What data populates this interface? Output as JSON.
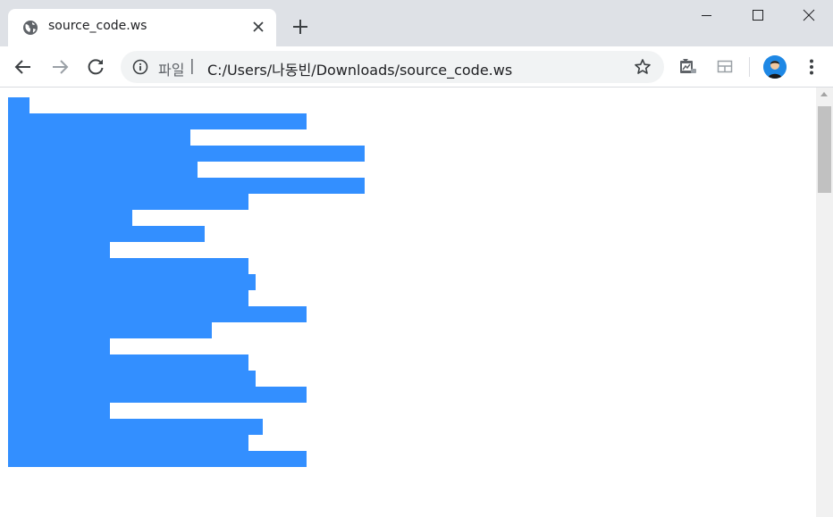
{
  "tab": {
    "title": "source_code.ws",
    "favicon": "globe-icon"
  },
  "window_controls": [
    "minimize-icon",
    "maximize-icon",
    "close-icon"
  ],
  "navigation": [
    "back-arrow-icon",
    "forward-arrow-icon",
    "reload-icon"
  ],
  "omnibox": {
    "scheme_label": "파일",
    "separator": "|",
    "url": "C:/Users/나동빈/Downloads/source_code.ws"
  },
  "toolbar_icons": [
    "bookmark-star-icon",
    "extension-icon",
    "cast-icon",
    "profile-avatar",
    "menu-kebab-icon"
  ],
  "selection": {
    "color": "#338fff",
    "line_units": [
      3,
      41,
      25,
      49,
      26,
      49,
      33,
      17,
      27,
      14,
      33,
      34,
      33,
      41,
      28,
      14,
      33,
      34,
      41,
      14,
      35,
      33,
      41
    ]
  },
  "colors": {
    "titlebar": "#dee1e6",
    "omnibox": "#f1f3f4",
    "selection": "#338fff"
  }
}
